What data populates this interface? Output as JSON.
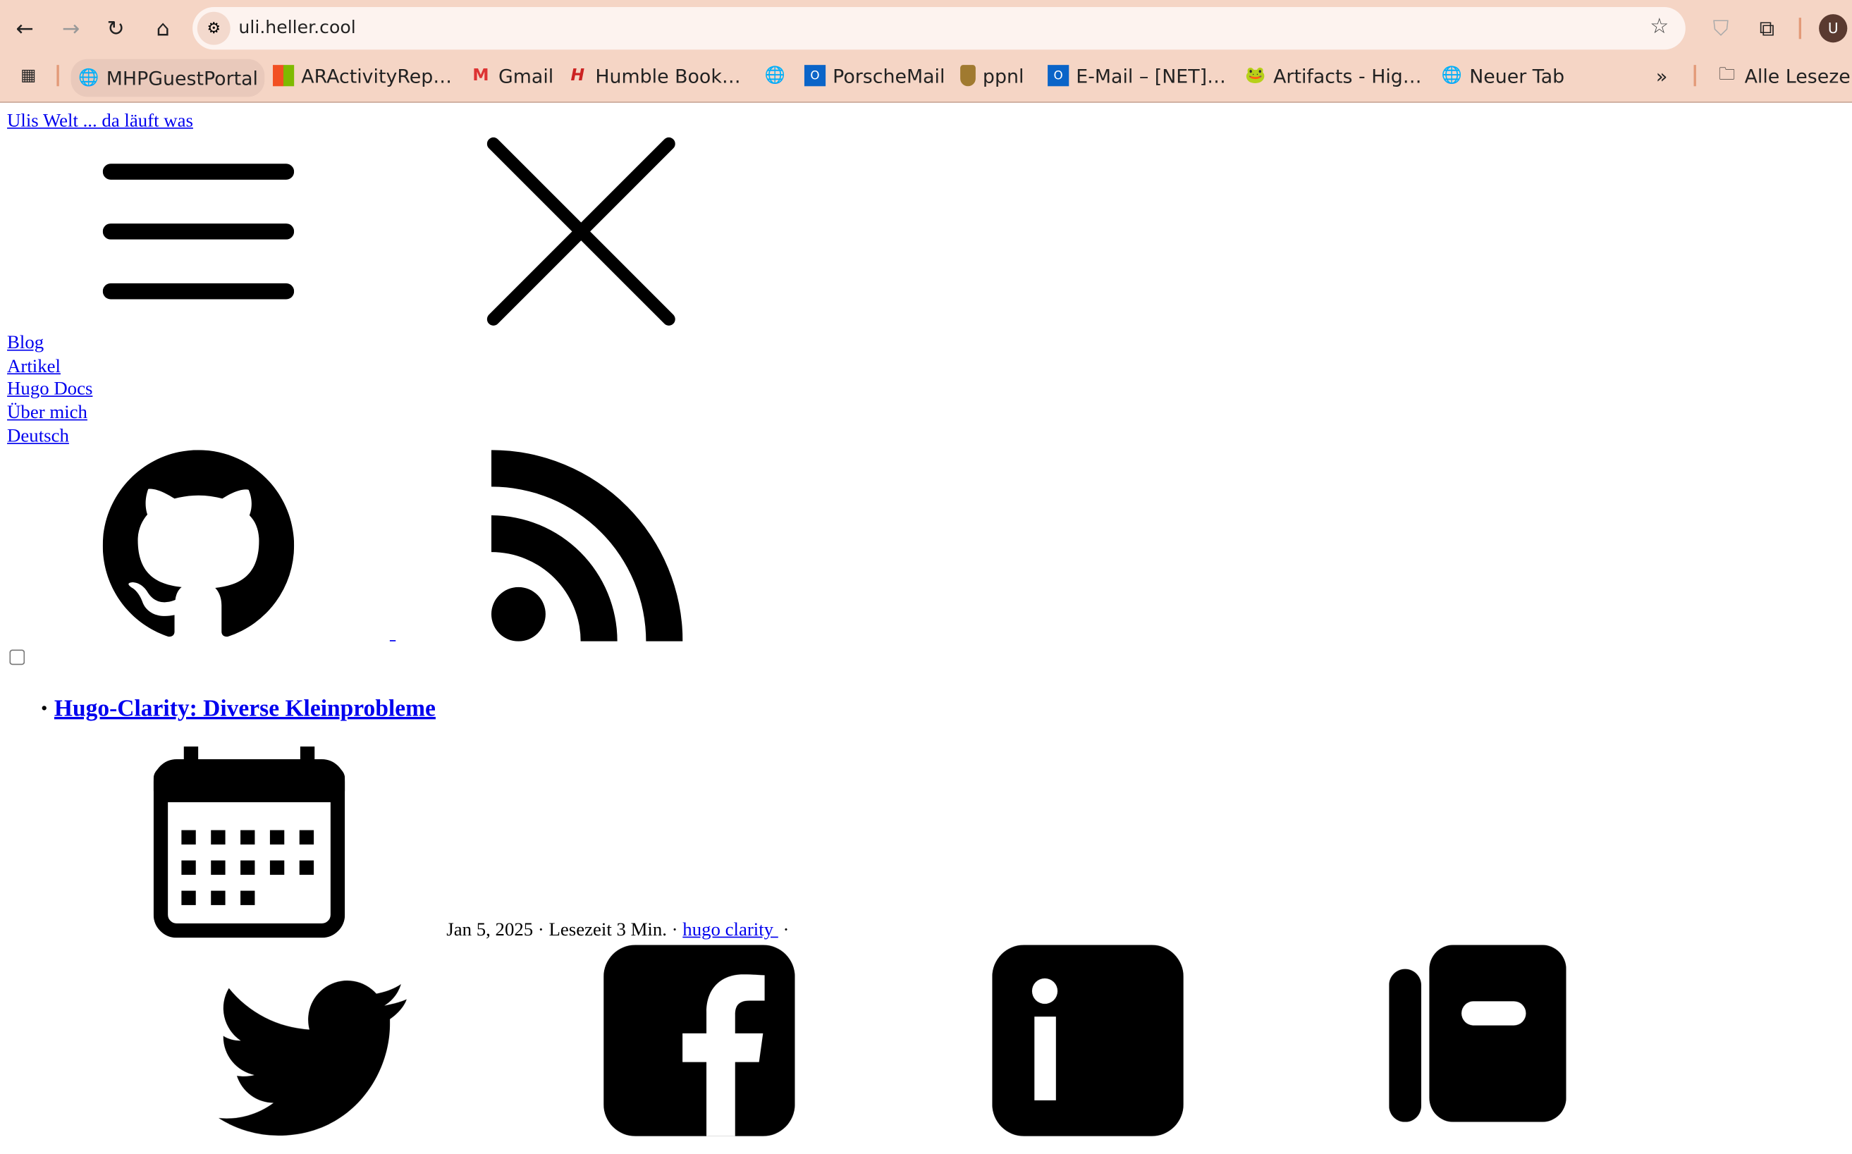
{
  "browser": {
    "url": "uli.heller.cool",
    "profile_initial": "U",
    "bookmarks": [
      {
        "label": "MHPGuestPortal",
        "icon": "globe-icon"
      },
      {
        "label": "ARActivityRep…",
        "icon": "microsoft-icon"
      },
      {
        "label": "Gmail",
        "icon": "gmail-icon"
      },
      {
        "label": "Humble Book…",
        "icon": "humble-icon"
      },
      {
        "label": "",
        "icon": "globe-icon"
      },
      {
        "label": "PorscheMail",
        "icon": "outlook-icon"
      },
      {
        "label": "ppnl",
        "icon": "porsche-icon"
      },
      {
        "label": "E-Mail – [NET]…",
        "icon": "outlook-icon"
      },
      {
        "label": "Artifacts - Hig…",
        "icon": "jfrog-icon"
      },
      {
        "label": "Neuer Tab",
        "icon": "globe-icon"
      }
    ],
    "overflow": "»",
    "all_bookmarks": "Alle Lesezeichen"
  },
  "page": {
    "logo_alt": "Ulis Welt ... da läuft was",
    "nav": [
      "Blog",
      "Artikel",
      "Hugo Docs",
      "Über mich",
      "Deutsch"
    ],
    "post": {
      "title": "Hugo-Clarity: Diverse Kleinprobleme",
      "meta": "Jan 5, 2025 · Lesezeit 3 Min. · ",
      "tag": "hugo clarity ",
      "meta_end": " ·"
    }
  }
}
